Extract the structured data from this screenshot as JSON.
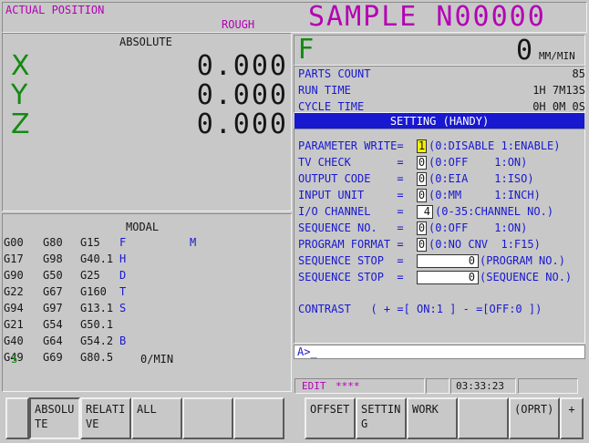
{
  "header": {
    "actual_position": "ACTUAL POSITION",
    "mode": "ROUGH",
    "program": "SAMPLE N00000"
  },
  "absolute": {
    "title": "ABSOLUTE",
    "axes": [
      {
        "name": "X",
        "value": "0.000"
      },
      {
        "name": "Y",
        "value": "0.000"
      },
      {
        "name": "Z",
        "value": "0.000"
      }
    ]
  },
  "modal": {
    "title": "MODAL",
    "rows": [
      [
        "G00",
        "G80",
        "G15",
        "F",
        ""
      ],
      [
        "G17",
        "G98",
        "G40.1",
        "H",
        ""
      ],
      [
        "G90",
        "G50",
        "G25",
        "D",
        ""
      ],
      [
        "G22",
        "G67",
        "G160",
        "T",
        ""
      ],
      [
        "G94",
        "G97",
        "G13.1",
        "S",
        ""
      ],
      [
        "G21",
        "G54",
        "G50.1",
        "",
        ""
      ],
      [
        "G40",
        "G64",
        "G54.2",
        "B",
        ""
      ],
      [
        "G49",
        "G69",
        "G80.5",
        "",
        ""
      ]
    ],
    "m_label": "M",
    "s_label": "S",
    "feed_unit": "0/MIN"
  },
  "feed": {
    "label": "F",
    "value": "0",
    "unit": "MM/MIN"
  },
  "counters": [
    {
      "label": "PARTS COUNT",
      "value": "85"
    },
    {
      "label": "RUN TIME",
      "value": "1H 7M13S"
    },
    {
      "label": "CYCLE TIME",
      "value": "0H 0M 0S"
    }
  ],
  "setting": {
    "title": "SETTING (HANDY)",
    "rows": [
      {
        "label": "PARAMETER WRITE=",
        "value": "1",
        "hint": "(0:DISABLE 1:ENABLE)"
      },
      {
        "label": "TV CHECK       =",
        "value": "0",
        "hint": "(0:OFF    1:ON)"
      },
      {
        "label": "OUTPUT CODE    =",
        "value": "0",
        "hint": "(0:EIA    1:ISO)"
      },
      {
        "label": "INPUT UNIT     =",
        "value": "0",
        "hint": "(0:MM     1:INCH)"
      },
      {
        "label": "I/O CHANNEL    =",
        "value": "4",
        "hint": "(0-35:CHANNEL NO.)"
      },
      {
        "label": "SEQUENCE NO.   =",
        "value": "0",
        "hint": "(0:OFF    1:ON)"
      },
      {
        "label": "PROGRAM FORMAT =",
        "value": "0",
        "hint": "(0:NO CNV  1:F15)"
      },
      {
        "label": "SEQUENCE STOP  =",
        "value": "0",
        "hint": "(PROGRAM NO.)"
      },
      {
        "label": "SEQUENCE STOP  =",
        "value": "0",
        "hint": "(SEQUENCE NO.)"
      }
    ],
    "contrast": "CONTRAST   ( + =[ ON:1 ] - =[OFF:0 ])"
  },
  "input": {
    "prompt": "A>_"
  },
  "status": {
    "mode": "EDIT",
    "stars": "****",
    "time": "03:33:23"
  },
  "softkeys": [
    "",
    "ABSOLUTE",
    "RELATIVE",
    "ALL",
    "",
    "",
    "OFFSET",
    "SETTING",
    "WORK",
    "",
    "(OPRT)",
    "+"
  ],
  "colors": {
    "accent_blue": "#1818d0",
    "purple": "#b400b4",
    "green": "#138a13",
    "highlight": "#f6f000"
  }
}
